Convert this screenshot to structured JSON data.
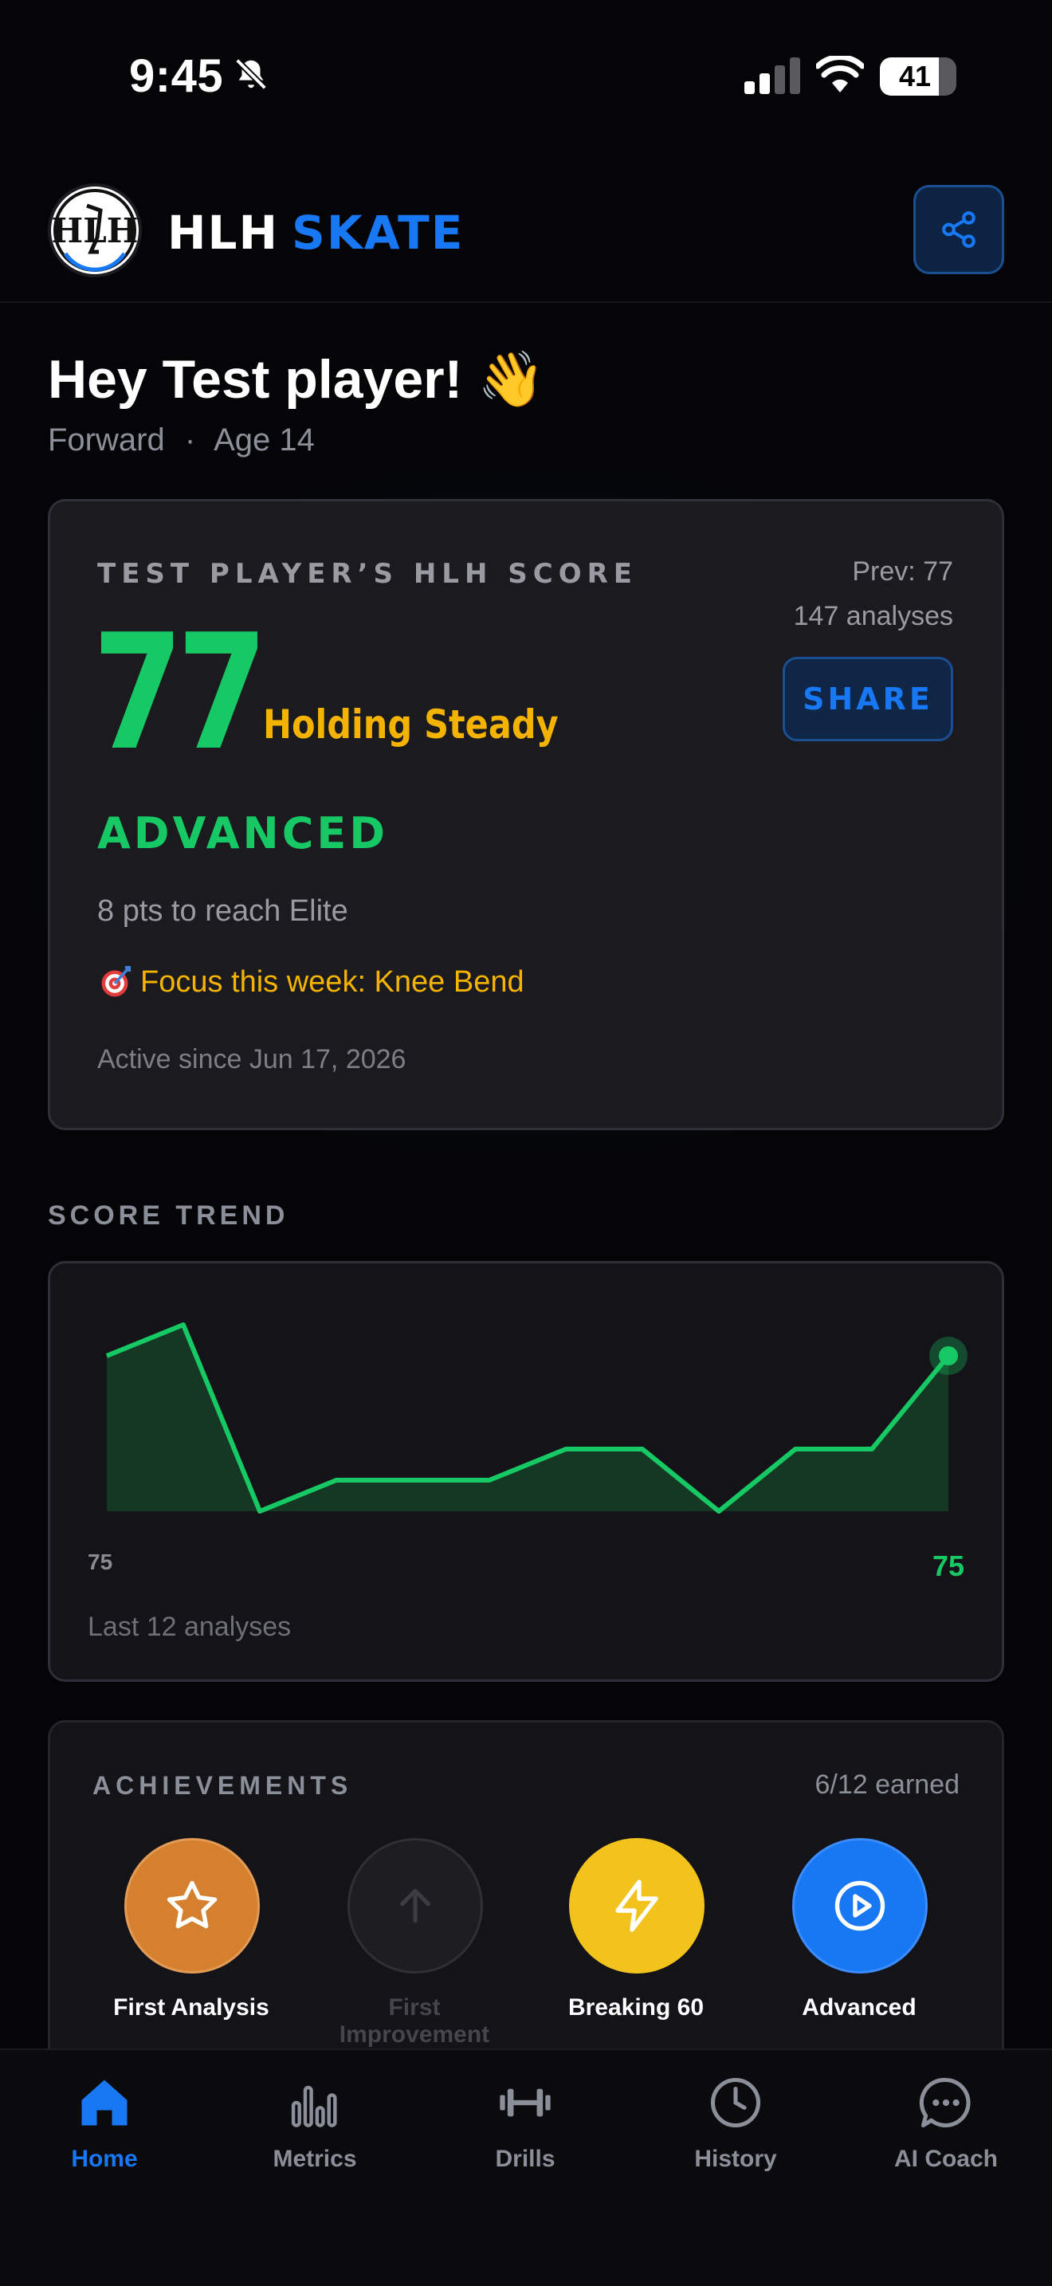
{
  "status_bar": {
    "time": "9:45",
    "battery": "41",
    "icons": [
      "bell-slash-icon",
      "signal-icon",
      "wifi-icon",
      "battery-icon"
    ]
  },
  "header": {
    "brand_left": "HLH",
    "brand_right": "SKATE",
    "logo_text": "HLH",
    "share_icon": "share-icon"
  },
  "greeting": {
    "title": "Hey Test player! 👋",
    "position": "Forward",
    "separator": "·",
    "age": "Age 14"
  },
  "score_card": {
    "label": "TEST PLAYER’S HLH SCORE",
    "prev": "Prev: 77",
    "analyses": "147 analyses",
    "share_label": "SHARE",
    "score": "77",
    "trend": "Holding Steady",
    "tier": "ADVANCED",
    "pts_to_next": "8 pts to reach Elite",
    "focus": "Focus this week: Knee Bend",
    "active_since": "Active since Jun 17, 2026"
  },
  "trend": {
    "title": "SCORE TREND",
    "min_label": "75",
    "max_label": "75",
    "note": "Last 12 analyses"
  },
  "chart_data": {
    "type": "area",
    "x": [
      1,
      2,
      3,
      4,
      5,
      6,
      7,
      8,
      9,
      10,
      11,
      12
    ],
    "values": [
      76.0,
      77.0,
      71.0,
      72.0,
      72.0,
      72.0,
      73.0,
      73.0,
      71.0,
      73.0,
      73.0,
      76.0
    ],
    "ylim": [
      71,
      77.0
    ],
    "colors": {
      "line": "#16c964",
      "fill": "#143824"
    }
  },
  "achievements": {
    "title": "ACHIEVEMENTS",
    "count": "6/12 earned",
    "items": [
      {
        "label": "First Analysis",
        "icon": "star-icon",
        "color": "#d4802f",
        "earned": true
      },
      {
        "label": "First Improvement",
        "icon": "arrow-up-icon",
        "color": "#1e1e22",
        "earned": false
      },
      {
        "label": "Breaking 60",
        "icon": "lightning-icon",
        "color": "#f2c31c",
        "earned": true
      },
      {
        "label": "Advanced",
        "icon": "play-circle-icon",
        "color": "#1877f2",
        "earned": true
      }
    ]
  },
  "nav": {
    "active_color": "#1877f2",
    "inactive_color": "#8a8f99",
    "items": [
      {
        "label": "Home",
        "icon": "home-icon",
        "active": true
      },
      {
        "label": "Metrics",
        "icon": "bar-chart-icon",
        "active": false
      },
      {
        "label": "Drills",
        "icon": "dumbbell-icon",
        "active": false
      },
      {
        "label": "History",
        "icon": "clock-icon",
        "active": false
      },
      {
        "label": "AI Coach",
        "icon": "chat-icon",
        "active": false
      }
    ]
  }
}
